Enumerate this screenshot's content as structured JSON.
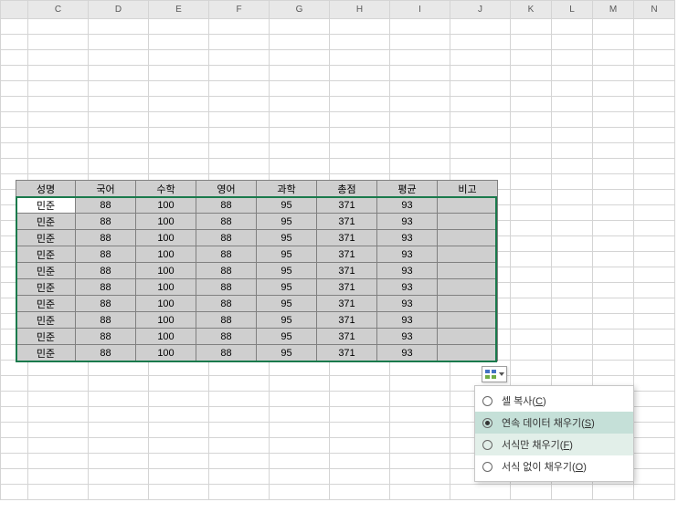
{
  "columns": [
    "C",
    "D",
    "E",
    "F",
    "G",
    "H",
    "I",
    "J",
    "K",
    "L",
    "M",
    "N"
  ],
  "col_widths": {
    "first_half": 17,
    "default": 53,
    "after_j": 44
  },
  "data_table": {
    "headers": [
      "성명",
      "국어",
      "수학",
      "영어",
      "과학",
      "총점",
      "평균",
      "비고"
    ],
    "rows": [
      {
        "name": "민준",
        "kor": "88",
        "math": "100",
        "eng": "88",
        "sci": "95",
        "total": "371",
        "avg": "93",
        "note": ""
      },
      {
        "name": "민준",
        "kor": "88",
        "math": "100",
        "eng": "88",
        "sci": "95",
        "total": "371",
        "avg": "93",
        "note": ""
      },
      {
        "name": "민준",
        "kor": "88",
        "math": "100",
        "eng": "88",
        "sci": "95",
        "total": "371",
        "avg": "93",
        "note": ""
      },
      {
        "name": "민준",
        "kor": "88",
        "math": "100",
        "eng": "88",
        "sci": "95",
        "total": "371",
        "avg": "93",
        "note": ""
      },
      {
        "name": "민준",
        "kor": "88",
        "math": "100",
        "eng": "88",
        "sci": "95",
        "total": "371",
        "avg": "93",
        "note": ""
      },
      {
        "name": "민준",
        "kor": "88",
        "math": "100",
        "eng": "88",
        "sci": "95",
        "total": "371",
        "avg": "93",
        "note": ""
      },
      {
        "name": "민준",
        "kor": "88",
        "math": "100",
        "eng": "88",
        "sci": "95",
        "total": "371",
        "avg": "93",
        "note": ""
      },
      {
        "name": "민준",
        "kor": "88",
        "math": "100",
        "eng": "88",
        "sci": "95",
        "total": "371",
        "avg": "93",
        "note": ""
      },
      {
        "name": "민준",
        "kor": "88",
        "math": "100",
        "eng": "88",
        "sci": "95",
        "total": "371",
        "avg": "93",
        "note": ""
      },
      {
        "name": "민준",
        "kor": "88",
        "math": "100",
        "eng": "88",
        "sci": "95",
        "total": "371",
        "avg": "93",
        "note": ""
      }
    ]
  },
  "autofill_menu": {
    "items": [
      {
        "label": "셀 복사",
        "key": "C",
        "selected": false,
        "hovered": false
      },
      {
        "label": "연속 데이터 채우기",
        "key": "S",
        "selected": true,
        "hovered": false
      },
      {
        "label": "서식만 채우기",
        "key": "F",
        "selected": false,
        "hovered": true
      },
      {
        "label": "서식 없이 채우기",
        "key": "O",
        "selected": false,
        "hovered": false
      }
    ]
  }
}
